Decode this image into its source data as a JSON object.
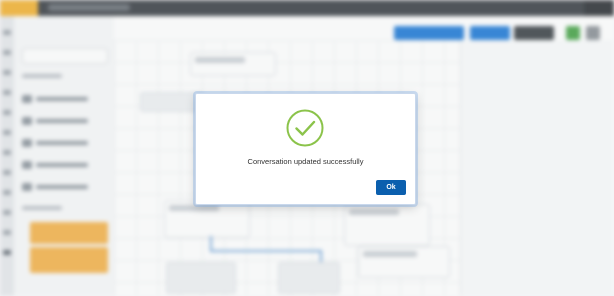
{
  "dialog": {
    "message": "Conversation updated successfully",
    "ok_label": "Ok",
    "icon": "check-circle-icon",
    "icon_color": "#8bc34a",
    "button_color": "#0b5fae"
  },
  "colors": {
    "brand": "#f2b233",
    "topbar": "#3b4046",
    "accent": "#1f7ad6"
  }
}
